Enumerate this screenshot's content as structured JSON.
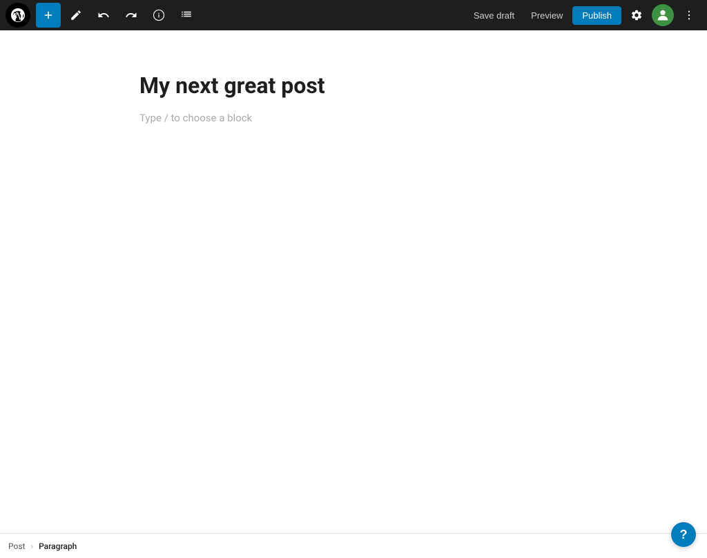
{
  "toolbar": {
    "wp_logo_alt": "WordPress",
    "add_block_label": "+",
    "tools_label": "Tools",
    "undo_label": "Undo",
    "redo_label": "Redo",
    "details_label": "Details",
    "list_view_label": "List View",
    "save_draft_label": "Save draft",
    "preview_label": "Preview",
    "publish_label": "Publish",
    "settings_label": "Settings",
    "avatar_label": "User",
    "more_label": "More tools & options"
  },
  "editor": {
    "post_title": "My next great post",
    "block_placeholder": "Type / to choose a block"
  },
  "breadcrumb": {
    "post_label": "Post",
    "separator": "›",
    "current_label": "Paragraph"
  },
  "help": {
    "label": "?"
  }
}
